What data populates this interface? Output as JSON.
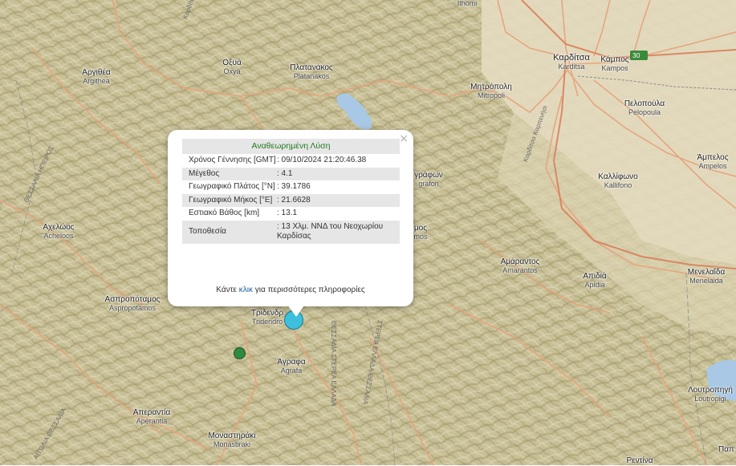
{
  "map": {
    "places": [
      {
        "id": "ithomi",
        "gr": "",
        "lat": "Ithomi"
      },
      {
        "id": "karditsa",
        "gr": "Καρδίτσα",
        "lat": "Karditsa"
      },
      {
        "id": "kampos",
        "gr": "Κάμπος",
        "lat": "Kampos"
      },
      {
        "id": "oxia",
        "gr": "Οξυά",
        "lat": "Oxya"
      },
      {
        "id": "platanakos",
        "gr": "Πλατανάκος",
        "lat": "Platanakos"
      },
      {
        "id": "argithea",
        "gr": "Αργιθέα",
        "lat": "Argithea"
      },
      {
        "id": "mitropoli",
        "gr": "Μητρόπολη",
        "lat": "Mitropoli"
      },
      {
        "id": "pelopoula",
        "gr": "Πελοπούλα",
        "lat": "Pelopoula"
      },
      {
        "id": "ampelos",
        "gr": "Άμπελος",
        "lat": "Ampelos"
      },
      {
        "id": "kallifono",
        "gr": "Καλλίφωνο",
        "lat": "Kallifono"
      },
      {
        "id": "grafon",
        "gr": "γράφων",
        "lat": "grafon"
      },
      {
        "id": "acheloos",
        "gr": "Αχελώος",
        "lat": "Acheloos"
      },
      {
        "id": "mos",
        "gr": "μος",
        "lat": "mos"
      },
      {
        "id": "amarantos",
        "gr": "Αμάραντος",
        "lat": "Amarantos"
      },
      {
        "id": "apidia",
        "gr": "Απιδιά",
        "lat": "Apidia"
      },
      {
        "id": "menelaida",
        "gr": "Μενελαΐδα",
        "lat": "Menelaida"
      },
      {
        "id": "aspropotamos",
        "gr": "Ασπροπόταμος",
        "lat": "Aspropotamos"
      },
      {
        "id": "tridendro",
        "gr": "Τριδενδρ",
        "lat": "Tridendro"
      },
      {
        "id": "agrafa",
        "gr": "Άγραφα",
        "lat": "Agrafa"
      },
      {
        "id": "loutropigi",
        "gr": "Λουτροπηγή",
        "lat": "Loutropigi"
      },
      {
        "id": "aperantia",
        "gr": "Απεραντία",
        "lat": "Aperantia"
      },
      {
        "id": "monastiraki",
        "gr": "Μοναστηράκι",
        "lat": "Monastiraki"
      },
      {
        "id": "pap",
        "gr": "Παπ",
        "lat": ""
      },
      {
        "id": "rentina",
        "gr": "Ρεντίνα",
        "lat": ""
      }
    ],
    "road_labels": {
      "karditsa_road": "Καρδίτσα Καρπενήσι",
      "thessalia": "ΘΕΣΣΑΛΙΑ ΣΤΕΡΕΑ ΕΛΛΑΔΑ",
      "sterea": "ΣΤΕΡΕΑ ΕΛΛΑΔΑ ΘΕΣΣΑΛΙΑ",
      "aitolia": "ΑΙΤΩΛΙΑ ΘΕΣΣΑΛΙΑ",
      "thessalia_left": "ΘΕΣΣΑΛΙΑ ΗΠΕΙΡΟΣ",
      "kartisa_top": "Καρδίτσα",
      "route": "30"
    },
    "colors": {
      "terrain": "#c9c29a",
      "road": "#e8a37c",
      "water": "#a8c8e6",
      "quake_recent": "#3cc0dc",
      "quake_old": "#2e8b3e"
    }
  },
  "popup": {
    "close": "×",
    "title": "Αναθεωρημένη Λύση",
    "rows": [
      {
        "label": "Χρόνος Γέννησης [GMT]",
        "value": ": 09/10/2024 21:20:46.38"
      },
      {
        "label": "Μέγεθος",
        "value": ": 4.1"
      },
      {
        "label": "Γεωγραφικό Πλάτος [°N]",
        "value": ": 39.1786"
      },
      {
        "label": "Γεωγραφικό Μήκος [°E]",
        "value": ": 21.6628"
      },
      {
        "label": "Εστιακό Βάθος [km]",
        "value": ": 13.1"
      },
      {
        "label": "Τοποθεσία",
        "value": ": 13 Χλμ. ΝΝΔ του Νεοχωρίου Καρδίσας"
      }
    ],
    "more_prefix": "Κάντε ",
    "more_link": "κλικ",
    "more_suffix": " για περισσότερες πληροφορίες"
  }
}
